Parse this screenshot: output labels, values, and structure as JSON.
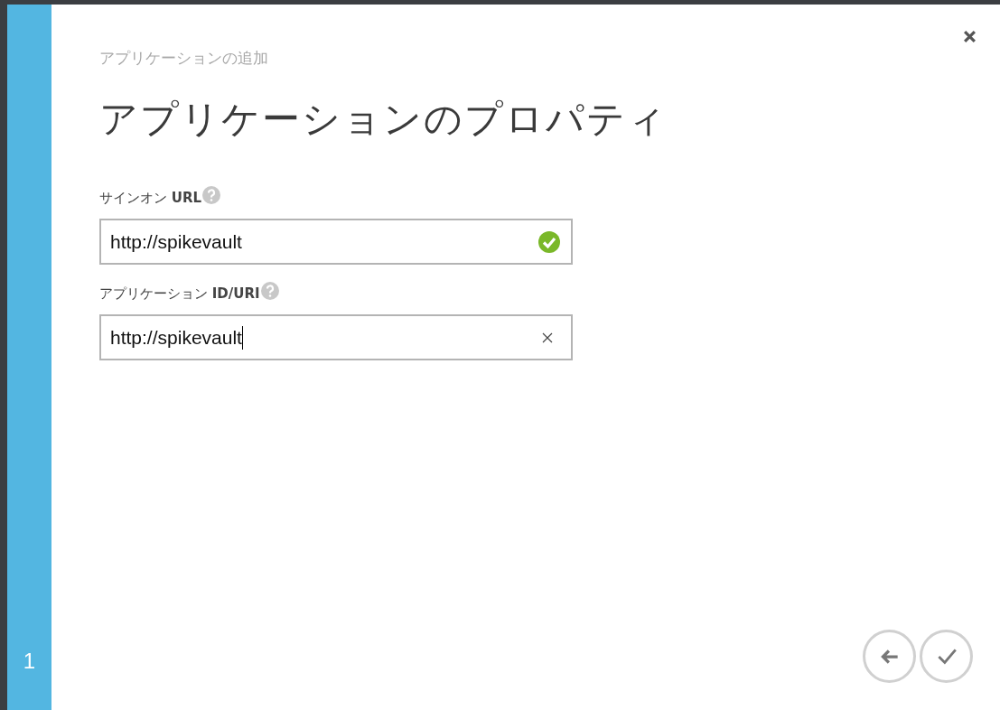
{
  "step": {
    "number": "1"
  },
  "dialog": {
    "subtitle": "アプリケーションの追加",
    "title": "アプリケーションのプロパティ"
  },
  "fields": [
    {
      "label": "サインオン **URL**",
      "value": "http://spikevault",
      "kind": "valid",
      "focused": false
    },
    {
      "label": "アプリケーション **ID/URI**",
      "value": "http://spikevault",
      "kind": "clearable",
      "focused": true
    }
  ],
  "buttons": [
    {
      "kind": "back"
    },
    {
      "kind": "finish"
    }
  ]
}
